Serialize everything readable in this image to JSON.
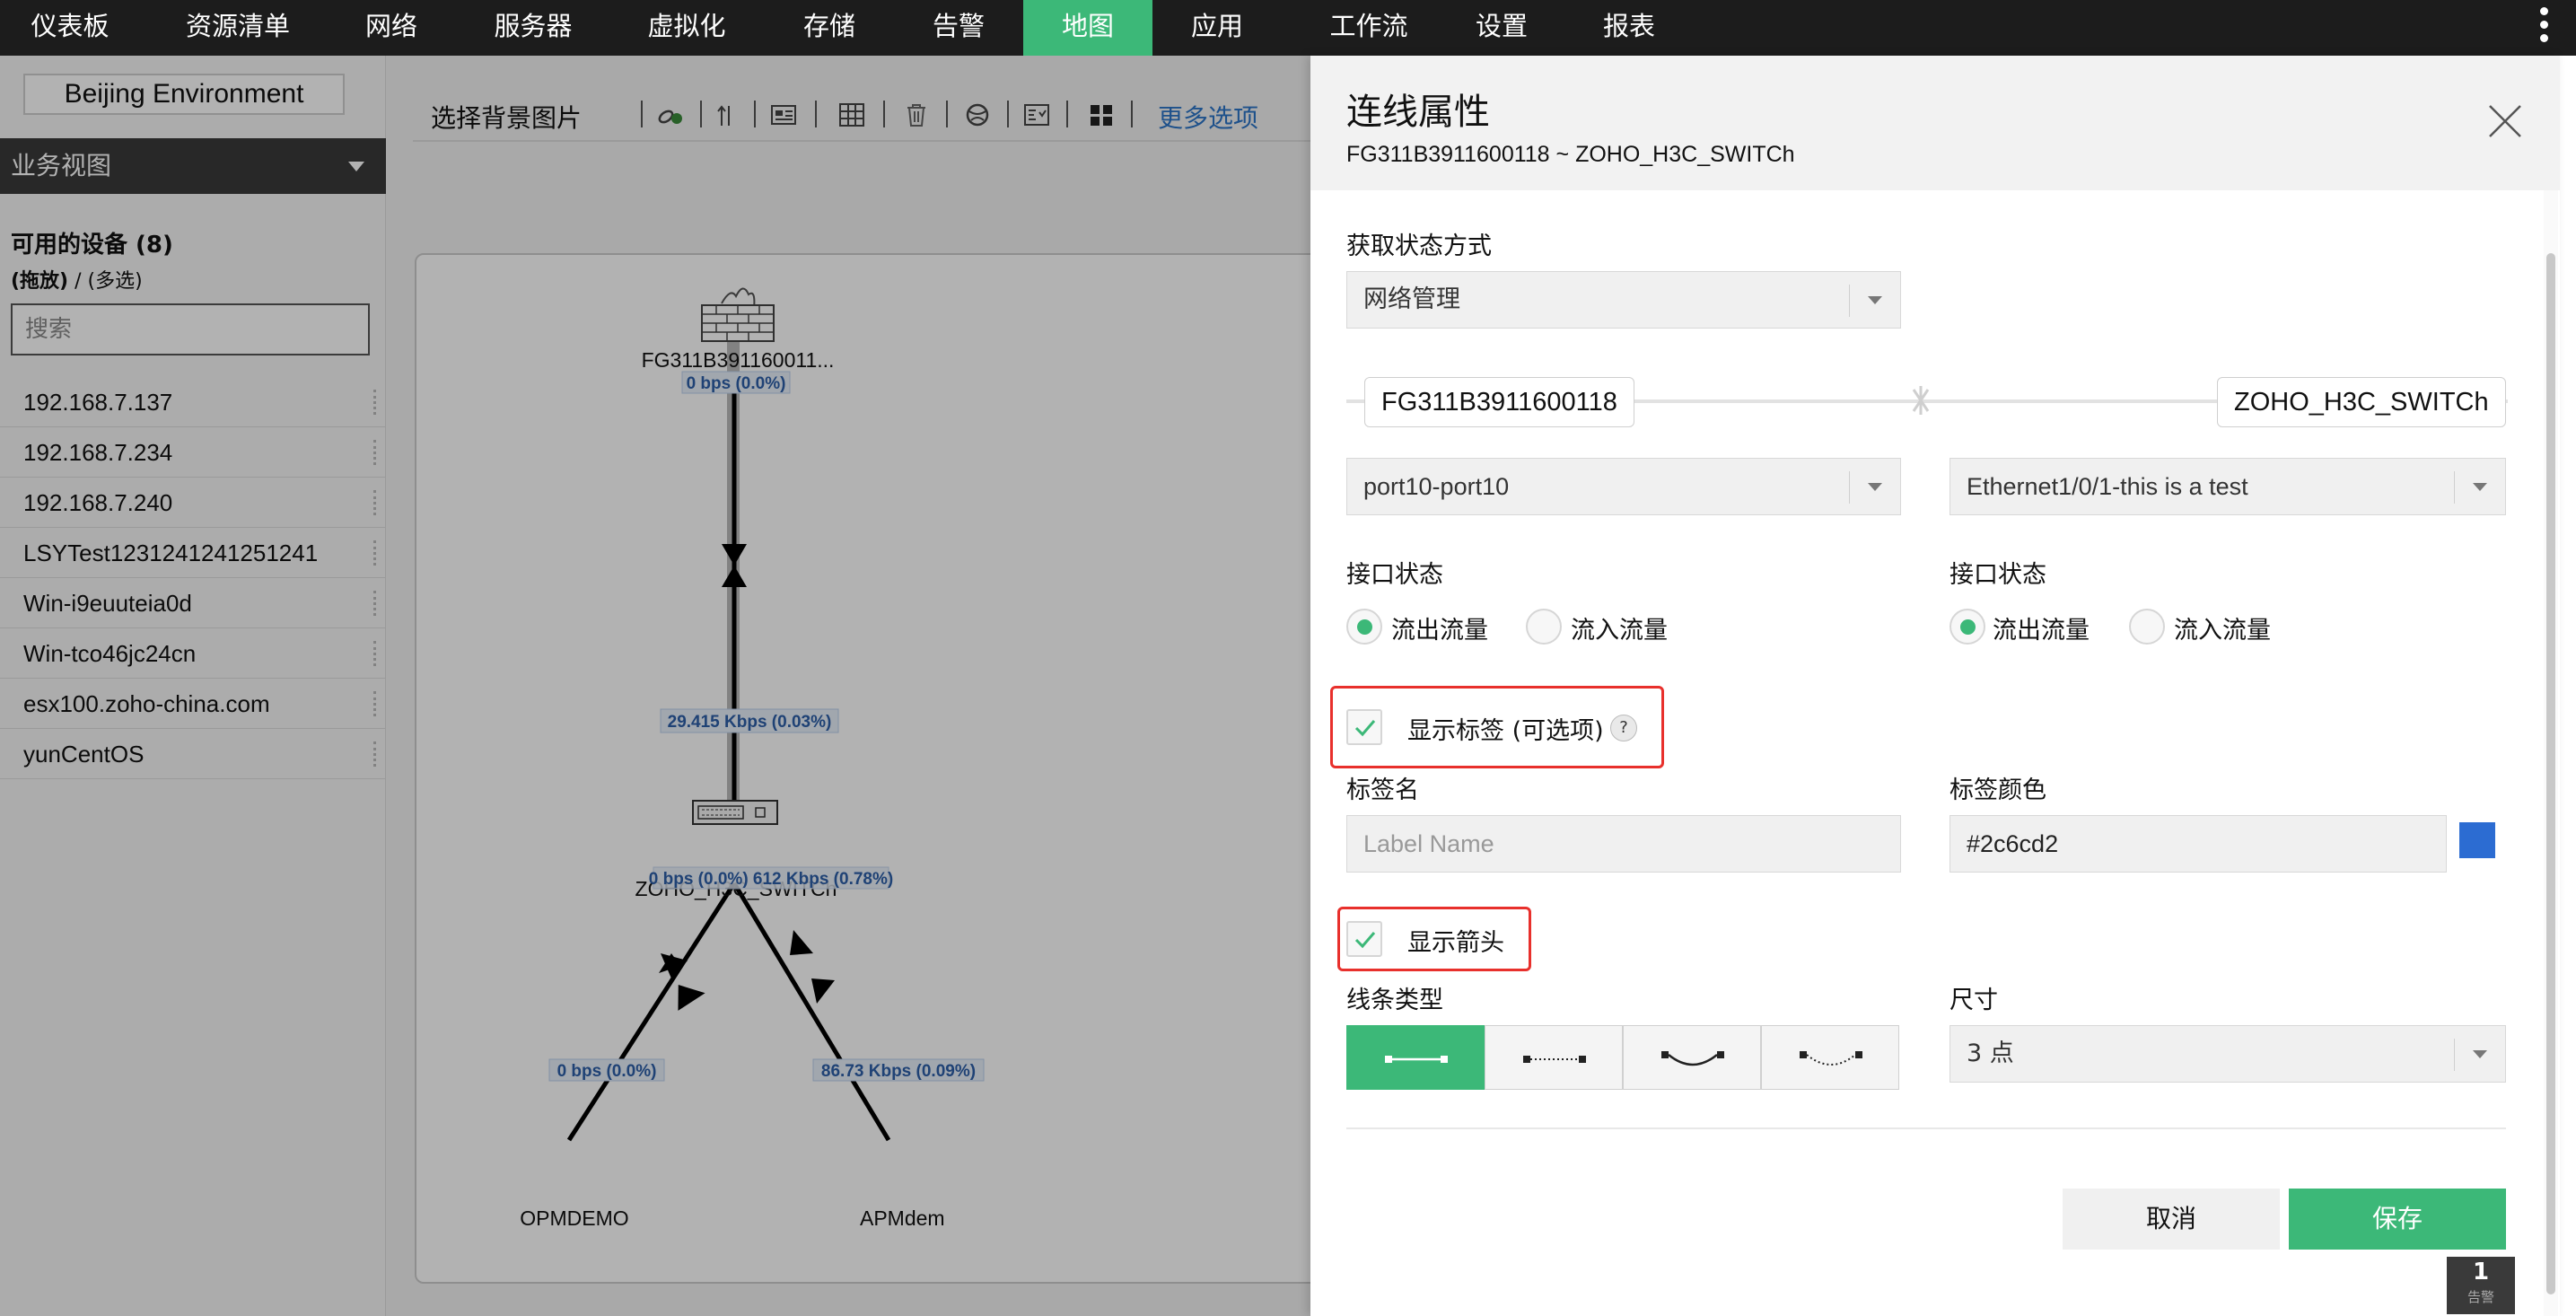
{
  "nav": {
    "items": [
      {
        "label": "仪表板"
      },
      {
        "label": "资源清单"
      },
      {
        "label": "网络"
      },
      {
        "label": "服务器"
      },
      {
        "label": "虚拟化"
      },
      {
        "label": "存储"
      },
      {
        "label": "告警"
      },
      {
        "label": "地图"
      },
      {
        "label": "应用"
      },
      {
        "label": "工作流"
      },
      {
        "label": "设置"
      },
      {
        "label": "报表"
      }
    ],
    "active": "地图"
  },
  "sidebar": {
    "environment": "Beijing Environment",
    "view_select": "业务视图",
    "available_title": "可用的设备 (8)",
    "available_sub_bold": "(拖放)",
    "available_sub_rest": " / (多选)",
    "search_placeholder": "搜索",
    "devices": [
      {
        "name": "192.168.7.137"
      },
      {
        "name": "192.168.7.234"
      },
      {
        "name": "192.168.7.240"
      },
      {
        "name": "LSYTest1231241241251241"
      },
      {
        "name": "Win-i9euuteia0d"
      },
      {
        "name": "Win-tco46jc24cn"
      },
      {
        "name": "esx100.zoho-china.com"
      },
      {
        "name": "yunCentOS"
      }
    ]
  },
  "toolbar": {
    "background_label": "选择背景图片",
    "more_options": "更多选项"
  },
  "map": {
    "nodes": {
      "firewall": "FG311B391160011...",
      "switch": "ZOHO_H3C_SWITCh",
      "opmdemo": "OPMDEMO",
      "apmdemo": "APMdem"
    },
    "links": {
      "fw_top": "0 bps (0.0%)",
      "fw_switch": "29.415 Kbps (0.03%)",
      "switch_bottom": "0 bps (0.0%) 612 Kbps (0.78%)",
      "left": "0 bps (0.0%)",
      "right": "86.73 Kbps (0.09%)"
    }
  },
  "panel": {
    "title": "连线属性",
    "subtitle": "FG311B3911600118 ~ ZOHO_H3C_SWITCh",
    "status_method_label": "获取状态方式",
    "status_method_value": "网络管理",
    "endpoint_a": "FG311B3911600118",
    "endpoint_b": "ZOHO_H3C_SWITCh",
    "interface_a": "port10-port10",
    "interface_b": "Ethernet1/0/1-this is a test",
    "iface_status_label": "接口状态",
    "outbound": "流出流量",
    "inbound": "流入流量",
    "status_a": "流出流量",
    "status_b": "流出流量",
    "show_label": "显示标签 (可选项)",
    "show_label_checked": true,
    "help": "?",
    "label_name_label": "标签名",
    "label_name_placeholder": "Label Name",
    "label_color_label": "标签颜色",
    "label_color_value": "#2c6cd2",
    "show_arrow": "显示箭头",
    "show_arrow_checked": true,
    "line_type_label": "线条类型",
    "line_types": [
      "solid-straight",
      "dotted-straight",
      "solid-curved",
      "dotted-curved"
    ],
    "line_type_selected": "solid-straight",
    "size_label": "尺寸",
    "size_value": "3 点",
    "cancel": "取消",
    "save": "保存"
  },
  "alarm_badge": {
    "count": "1",
    "label": "告警"
  },
  "colors": {
    "accent": "#3cb878",
    "nav_bg": "#1c1c1c",
    "highlight": "#e8302c",
    "link_label": "#2d5fa8"
  }
}
